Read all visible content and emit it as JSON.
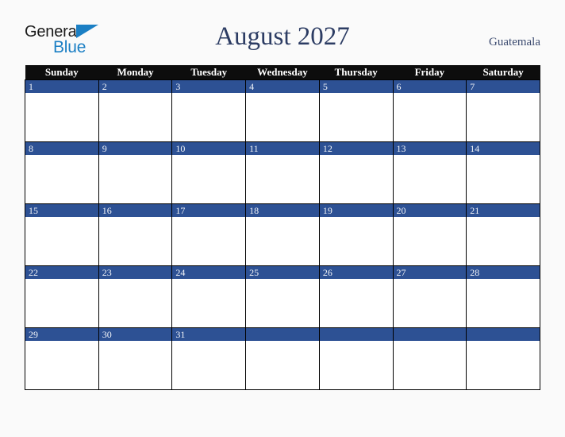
{
  "brand": {
    "name_part1": "General",
    "name_part2": "Blue",
    "triangle_icon": "triangle-icon",
    "blue_color": "#1b7fc4"
  },
  "header": {
    "title": "August 2027",
    "month": "August",
    "year": "2027",
    "country": "Guatemala",
    "title_color": "#2c3c63"
  },
  "calendar": {
    "weekday_headers": [
      "Sunday",
      "Monday",
      "Tuesday",
      "Wednesday",
      "Thursday",
      "Friday",
      "Saturday"
    ],
    "header_bg": "#0d0d0d",
    "banner_bg": "#2d5194",
    "cell_bg": "#ffffff",
    "weeks": [
      {
        "days": [
          {
            "number": "1"
          },
          {
            "number": "2"
          },
          {
            "number": "3"
          },
          {
            "number": "4"
          },
          {
            "number": "5"
          },
          {
            "number": "6"
          },
          {
            "number": "7"
          }
        ]
      },
      {
        "days": [
          {
            "number": "8"
          },
          {
            "number": "9"
          },
          {
            "number": "10"
          },
          {
            "number": "11"
          },
          {
            "number": "12"
          },
          {
            "number": "13"
          },
          {
            "number": "14"
          }
        ]
      },
      {
        "days": [
          {
            "number": "15"
          },
          {
            "number": "16"
          },
          {
            "number": "17"
          },
          {
            "number": "18"
          },
          {
            "number": "19"
          },
          {
            "number": "20"
          },
          {
            "number": "21"
          }
        ]
      },
      {
        "days": [
          {
            "number": "22"
          },
          {
            "number": "23"
          },
          {
            "number": "24"
          },
          {
            "number": "25"
          },
          {
            "number": "26"
          },
          {
            "number": "27"
          },
          {
            "number": "28"
          }
        ]
      },
      {
        "days": [
          {
            "number": "29"
          },
          {
            "number": "30"
          },
          {
            "number": "31"
          },
          {
            "number": ""
          },
          {
            "number": ""
          },
          {
            "number": ""
          },
          {
            "number": ""
          }
        ]
      }
    ]
  }
}
